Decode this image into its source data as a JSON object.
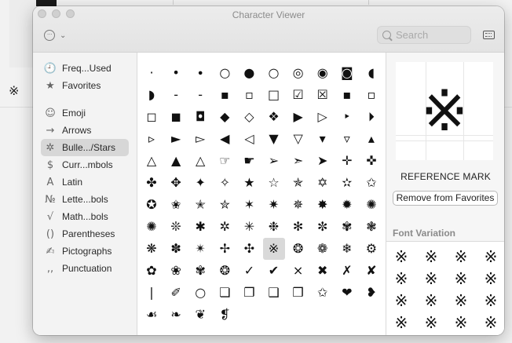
{
  "window": {
    "title": "Character Viewer",
    "search": {
      "placeholder": "Search",
      "value": ""
    }
  },
  "sidebar": {
    "selected_index": 4,
    "items": [
      {
        "label": "Freq...Used",
        "icon": "clock-icon",
        "glyph": "🕘"
      },
      {
        "label": "Favorites",
        "icon": "star-icon",
        "glyph": "★"
      },
      {
        "label": "Emoji",
        "icon": "smiley-icon",
        "glyph": "☺"
      },
      {
        "label": "Arrows",
        "icon": "arrow-icon",
        "glyph": "→"
      },
      {
        "label": "Bulle.../Stars",
        "icon": "asterisk-icon",
        "glyph": "✲"
      },
      {
        "label": "Curr...mbols",
        "icon": "dollar-icon",
        "glyph": "$"
      },
      {
        "label": "Latin",
        "icon": "latin-a-icon",
        "glyph": "A"
      },
      {
        "label": "Lette...bols",
        "icon": "numero-icon",
        "glyph": "№"
      },
      {
        "label": "Math...bols",
        "icon": "sqrt-icon",
        "glyph": "√"
      },
      {
        "label": "Parentheses",
        "icon": "parentheses-icon",
        "glyph": "()"
      },
      {
        "label": "Pictographs",
        "icon": "pencil-icon",
        "glyph": "✍"
      },
      {
        "label": "Punctuation",
        "icon": "quote-icon",
        "glyph": ",,"
      }
    ]
  },
  "grid": {
    "selected": "※",
    "rows": [
      [
        "·",
        "•",
        "∙",
        "○",
        "●",
        "○",
        "◎",
        "◉",
        "◙",
        "◖"
      ],
      [
        "◗",
        "‐",
        "-",
        "▪",
        "▫",
        "□",
        "☑",
        "☒",
        "▪",
        "▫"
      ],
      [
        "◻",
        "◼",
        "◘",
        "◆",
        "◇",
        "❖",
        "▶",
        "▷",
        "‣",
        "⏵"
      ],
      [
        "▹",
        "►",
        "▻",
        "◀",
        "◁",
        "▼",
        "▽",
        "▾",
        "▿",
        "▴"
      ],
      [
        "△",
        "▲",
        "△",
        "☞",
        "☛",
        "➢",
        "➣",
        "➤",
        "✛",
        "✜"
      ],
      [
        "✤",
        "✥",
        "✦",
        "✧",
        "★",
        "☆",
        "✯",
        "✡",
        "✫",
        "✩"
      ],
      [
        "✪",
        "✬",
        "✭",
        "✮",
        "✶",
        "✷",
        "✵",
        "✸",
        "✹",
        "✺"
      ],
      [
        "✺",
        "❊",
        "✱",
        "✲",
        "✳",
        "❉",
        "✻",
        "✼",
        "✾",
        "❃"
      ],
      [
        "❋",
        "✽",
        "✴",
        "✢",
        "✣",
        "※",
        "❂",
        "❁",
        "❄",
        "⚙"
      ],
      [
        "✿",
        "❀",
        "✾",
        "❂",
        "✓",
        "✔",
        "×",
        "✖",
        "✗",
        "✘"
      ],
      [
        "❘",
        "✐",
        "○",
        "❏",
        "❐",
        "❑",
        "❒",
        "✩",
        "❤",
        "❥"
      ],
      [
        "☙",
        "❧",
        "❦",
        "❡"
      ]
    ]
  },
  "detail": {
    "preview_glyph": "※",
    "char_name": "REFERENCE MARK",
    "favorites_button": "Remove from Favorites",
    "font_variation_title": "Font Variation",
    "variations": [
      "※",
      "※",
      "※",
      "※",
      "※",
      "※",
      "※",
      "※",
      "※",
      "※",
      "※",
      "※",
      "※",
      "※",
      "※",
      "※",
      "※",
      "※",
      "※",
      "※"
    ]
  },
  "background": {
    "glyph": "※"
  }
}
